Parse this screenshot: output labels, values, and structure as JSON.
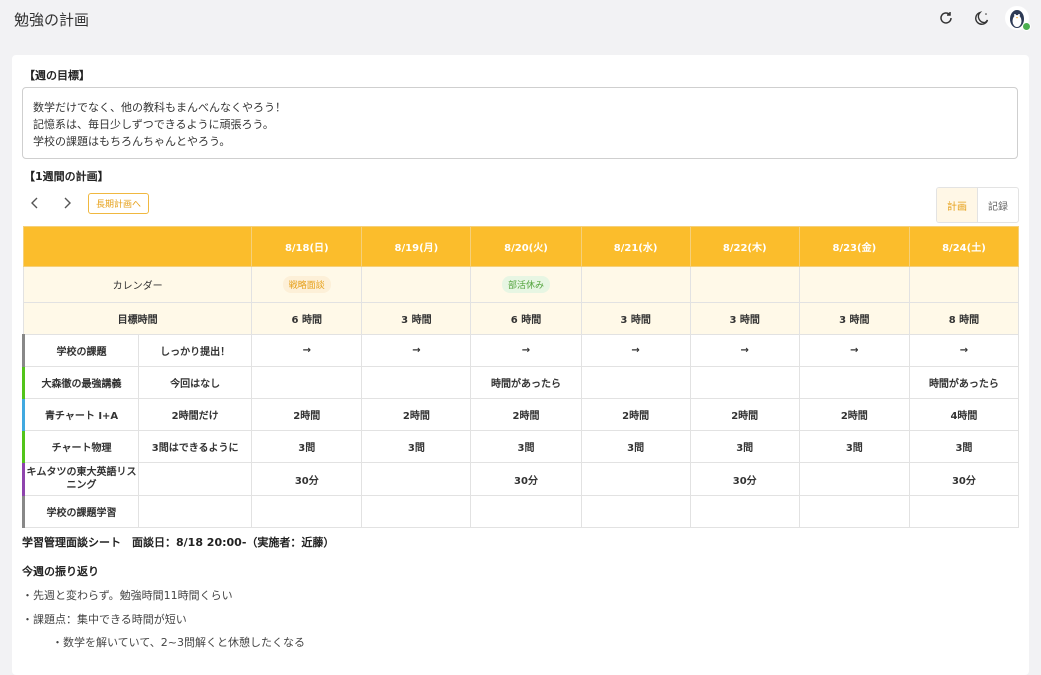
{
  "header": {
    "title": "勉強の計画",
    "icons": [
      "refresh-icon",
      "moon-icon",
      "penguin-avatar"
    ]
  },
  "goals": {
    "label": "【週の目標】",
    "lines": [
      "数学だけでなく、他の教科もまんべんなくやろう！",
      "記憶系は、毎日少しずつできるように頑張ろう。",
      "学校の課題はもちろんちゃんとやろう。"
    ]
  },
  "weekly_plan": {
    "label": "【1週間の計画】",
    "long_plan_button": "長期計画へ",
    "toggle": {
      "plan": "計画",
      "record": "記録",
      "active": "plan"
    },
    "dates": [
      "8/18(日)",
      "8/19(月)",
      "8/20(火)",
      "8/21(水)",
      "8/22(木)",
      "8/23(金)",
      "8/24(土)"
    ],
    "calendar_label": "カレンダー",
    "calendar": [
      "戦略面談",
      "",
      "部活休み",
      "",
      "",
      "",
      ""
    ],
    "target_label": "目標時間",
    "target_hours": [
      "6 時間",
      "3 時間",
      "6 時間",
      "3 時間",
      "3 時間",
      "3 時間",
      "8 時間"
    ],
    "subjects": [
      {
        "name": "学校の課題",
        "note": "しっかり提出！",
        "color": "#888888",
        "cells": [
          "→",
          "→",
          "→",
          "→",
          "→",
          "→",
          "→"
        ]
      },
      {
        "name": "大森徹の最強講義",
        "note": "今回はなし",
        "color": "#52c41a",
        "cells": [
          "",
          "",
          "時間があったら",
          "",
          "",
          "",
          "時間があったら"
        ]
      },
      {
        "name": "青チャート I+A",
        "note": "2時間だけ",
        "color": "#40a9e0",
        "cells": [
          "2時間",
          "2時間",
          "2時間",
          "2時間",
          "2時間",
          "2時間",
          "4時間"
        ]
      },
      {
        "name": "チャート物理",
        "note": "3問はできるように",
        "color": "#52c41a",
        "cells": [
          "3問",
          "3問",
          "3問",
          "3問",
          "3問",
          "3問",
          "3問"
        ]
      },
      {
        "name": "キムタツの東大英語リスニング",
        "note": "",
        "color": "#8e44ad",
        "cells": [
          "30分",
          "",
          "30分",
          "",
          "30分",
          "",
          "30分"
        ]
      },
      {
        "name": "学校の課題学習",
        "note": "",
        "color": "#888888",
        "cells": [
          "",
          "",
          "",
          "",
          "",
          "",
          ""
        ]
      }
    ]
  },
  "interview": {
    "sheet_title": "学習管理面談シート　面談日：8/18 20:00-（実施者：近藤）",
    "review_title": "今週の振り返り",
    "lines": [
      "・先週と変わらず。勉強時間11時間くらい",
      "・課題点：集中できる時間が短い",
      "・数学を解いていて、2~3問解くと休憩したくなる"
    ]
  }
}
